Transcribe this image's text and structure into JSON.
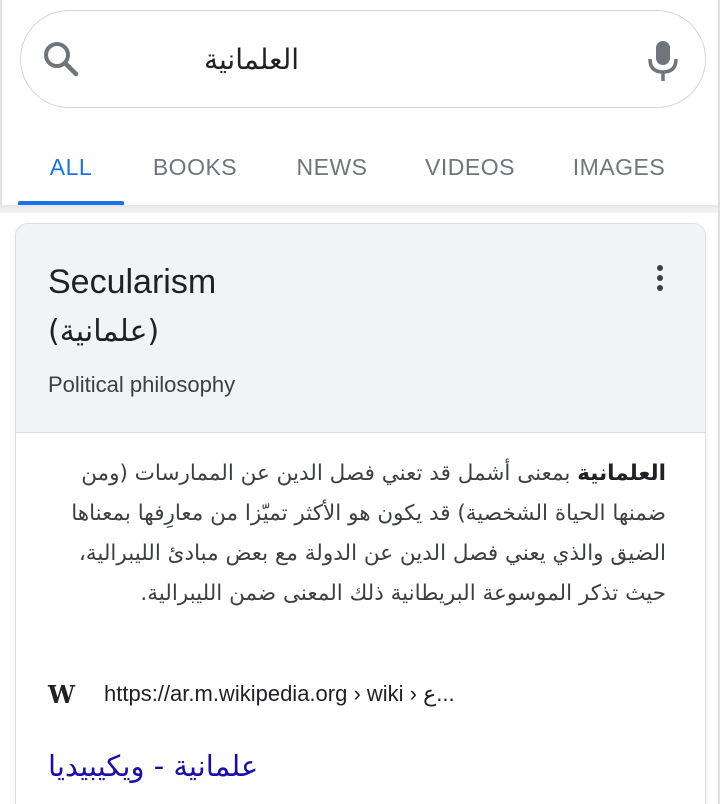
{
  "search": {
    "query": "العلمانية"
  },
  "tabs": [
    {
      "label": "ALL",
      "active": true
    },
    {
      "label": "BOOKS",
      "active": false
    },
    {
      "label": "NEWS",
      "active": false
    },
    {
      "label": "VIDEOS",
      "active": false
    },
    {
      "label": "IMAGES",
      "active": false
    }
  ],
  "knowledge_panel": {
    "title": "Secularism",
    "alt_title": "(علمانية)",
    "subtitle": "Political philosophy",
    "description_bold": "العلمانية",
    "description_rest": " بمعنى أشمل قد تعني فصل الدين عن الممارسات (ومن ضمنها الحياة الشخصية) قد يكون هو الأكثر تميّزا من معارِفها بمعناها الضيق والذي يعني فصل الدين عن الدولة مع بعض مبادئ الليبرالية، حيث تذكر الموسوعة البريطانية ذلك المعنى ضمن الليبرالية.",
    "source_icon": "W",
    "source_url": "https://ar.m.wikipedia.org › wiki › ع...",
    "source_link": "علمانية - ويكيبيديا"
  },
  "icons": {
    "search": "search-icon",
    "mic": "microphone-icon",
    "more": "more-vert-icon",
    "wikipedia": "wikipedia-icon"
  },
  "colors": {
    "accent": "#1a73e8",
    "link": "#1a0dab",
    "tab_inactive": "#70757a",
    "panel_header_bg": "#f1f3f4"
  }
}
